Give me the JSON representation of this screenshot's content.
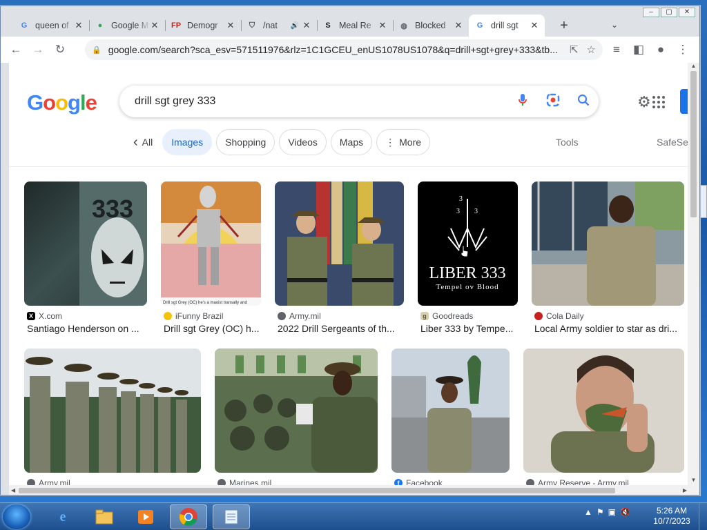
{
  "window": {
    "buttons": [
      "–",
      "▢",
      "✕"
    ]
  },
  "tabs": [
    {
      "title": "queen of",
      "icon": "google-icon",
      "glyph": "G",
      "color": "#4285f4"
    },
    {
      "title": "Google M",
      "icon": "maps-pin-icon",
      "glyph": "●",
      "color": "#34a853"
    },
    {
      "title": "Demogr",
      "icon": "fp-icon",
      "glyph": "FP",
      "color": "#c5221f"
    },
    {
      "title": "/nat",
      "icon": "shield-icon",
      "glyph": "⛉",
      "color": "#555555",
      "audio": "🔊"
    },
    {
      "title": "Meal Re",
      "icon": "s-icon",
      "glyph": "S",
      "color": "#202124"
    },
    {
      "title": "Blocked",
      "icon": "globe-icon",
      "glyph": "◍",
      "color": "#5f6368"
    },
    {
      "title": "drill sgt",
      "icon": "google-icon",
      "glyph": "G",
      "color": "#4285f4",
      "active": true
    }
  ],
  "toolbar": {
    "url": "google.com/search?sca_esv=571511976&rlz=1C1GCEU_enUS1078US1078&q=drill+sgt+grey+333&tb..."
  },
  "google": {
    "logo_letters": [
      "G",
      "o",
      "o",
      "g",
      "l",
      "e"
    ],
    "query": "drill sgt grey 333"
  },
  "chips": [
    {
      "label": "All",
      "prefix": "‹",
      "plain": true
    },
    {
      "label": "Images",
      "selected": true
    },
    {
      "label": "Shopping"
    },
    {
      "label": "Videos"
    },
    {
      "label": "Maps"
    },
    {
      "label": "More",
      "prefix": "⋮"
    }
  ],
  "tools_label": "Tools",
  "safesearch_label": "SafeSe",
  "results": [
    {
      "source": "X.com",
      "title": "Santiago Henderson on ...",
      "fav": "X",
      "favbg": "#000000"
    },
    {
      "source": "iFunny Brazil",
      "title": "Drill sgt Grey (OC) h...",
      "fav": "☺",
      "favbg": "#f4c20d"
    },
    {
      "source": "Army.mil",
      "title": "2022 Drill Sergeants of th...",
      "fav": "◍",
      "favbg": "#5f6368"
    },
    {
      "source": "Goodreads",
      "title": "Liber 333 by Tempe...",
      "fav": "g",
      "favbg": "#d7cfb0"
    },
    {
      "source": "Cola Daily",
      "title": "Local Army soldier to star as dri...",
      "fav": "◐",
      "favbg": "#c5221f"
    },
    {
      "source": "Army.mil",
      "title": "",
      "fav": "◍",
      "favbg": "#5f6368"
    },
    {
      "source": "Marines.mil",
      "title": "",
      "fav": "◍",
      "favbg": "#5f6368"
    },
    {
      "source": "Facebook",
      "title": "",
      "fav": "f",
      "favbg": "#1877f2"
    },
    {
      "source": "Army Reserve - Army.mil",
      "title": "",
      "fav": "◍",
      "favbg": "#5f6368"
    }
  ],
  "image_text": {
    "top_number": "333",
    "liber": "LIBER 333",
    "tempel": "Tempel ov Blood",
    "caption": "Drill sgt Grey (OC) he's a maoist transally and"
  },
  "taskbar": {
    "time": "5:26 AM",
    "date": "10/7/2023"
  }
}
